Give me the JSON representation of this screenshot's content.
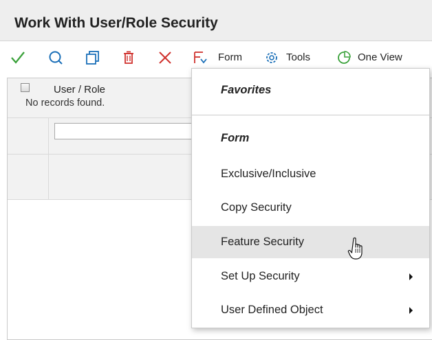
{
  "window": {
    "title": "Work With User/Role Security"
  },
  "colors": {
    "accent": "#1a6fb8",
    "ok": "#3aa13a",
    "delete": "#d0312d",
    "menu_hover": "#e5e5e5"
  },
  "toolbar": {
    "select_icon": "check-icon",
    "find_icon": "search-icon",
    "copy_icon": "copy-icon",
    "delete_icon": "trash-icon",
    "close_icon": "close-icon",
    "form_icon": "form-exit-icon",
    "form_label": "Form",
    "tools_icon": "gear-icon",
    "tools_label": "Tools",
    "oneview_icon": "one-view-icon",
    "oneview_label": "One View"
  },
  "grid": {
    "status": "No records found.",
    "columns": [
      "User / Role"
    ]
  },
  "menu": {
    "favorites_heading": "Favorites",
    "form_heading": "Form",
    "items": [
      {
        "label": "Exclusive/Inclusive",
        "has_submenu": false
      },
      {
        "label": "Copy Security",
        "has_submenu": false
      },
      {
        "label": "Feature Security",
        "has_submenu": false,
        "hovered": true
      },
      {
        "label": "Set Up Security",
        "has_submenu": true
      },
      {
        "label": "User Defined Object",
        "has_submenu": true
      }
    ]
  }
}
